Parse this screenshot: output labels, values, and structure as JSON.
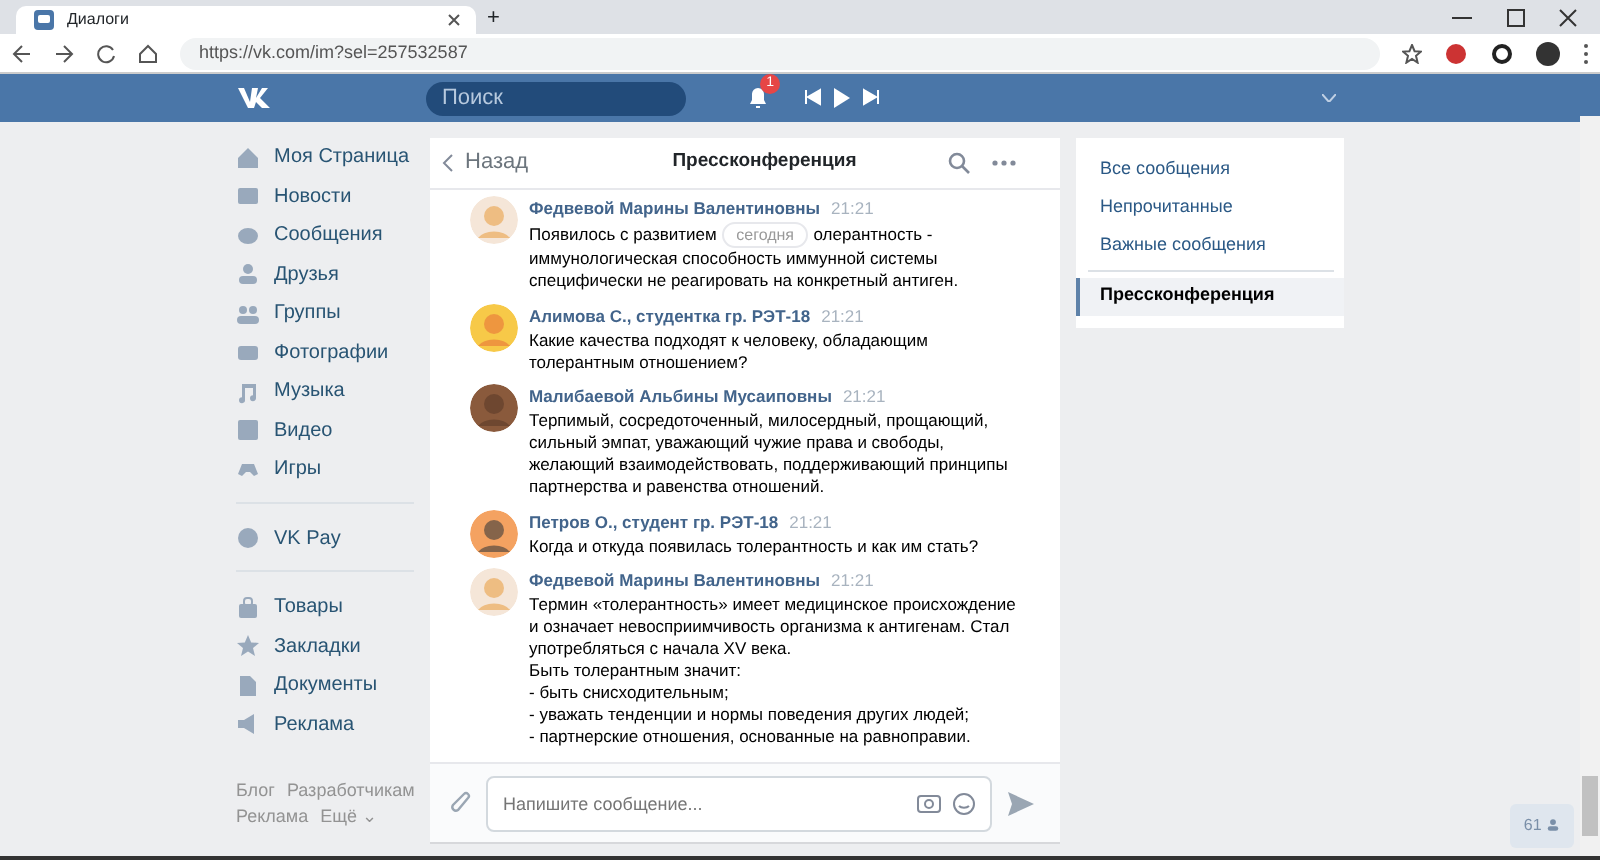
{
  "browser": {
    "tab_title": "Диалоги",
    "new_tab": "+",
    "url": "https://vk.com/im?sel=257532587"
  },
  "header": {
    "search_placeholder": "Поиск",
    "notification_count": "1"
  },
  "sidebar": {
    "groups": [
      [
        {
          "label": "Моя Страница"
        },
        {
          "label": "Новости"
        },
        {
          "label": "Сообщения"
        },
        {
          "label": "Друзья"
        },
        {
          "label": "Группы"
        },
        {
          "label": "Фотографии"
        },
        {
          "label": "Музыка"
        },
        {
          "label": "Видео"
        },
        {
          "label": "Игры"
        }
      ],
      [
        {
          "label": "VK Pay"
        }
      ],
      [
        {
          "label": "Товары"
        },
        {
          "label": "Закладки"
        },
        {
          "label": "Документы"
        },
        {
          "label": "Реклама"
        }
      ]
    ],
    "footer_links": [
      "Блог",
      "Разработчикам",
      "Реклама",
      "Ещё ⌄"
    ]
  },
  "chat": {
    "back": "Назад",
    "title": "Пресcконференция",
    "date_pill": "сегодня",
    "messages": [
      {
        "author": "Федвевой Марины Валентиновны",
        "time": "21:21",
        "text_parts": [
          "Появилось с развитием",
          "олерантность -",
          "иммунологическая способность иммунной системы\nспецифически не реагировать на конкретный антиген."
        ]
      },
      {
        "author": "Алимова С., студентка гр. РЭТ-18",
        "time": "21:21",
        "text_parts": [
          "Какие качества подходят к человеку, обладающим\nтолерантным отношением?"
        ]
      },
      {
        "author": "Малибаевой Альбины Мусаиповны",
        "time": "21:21",
        "text_parts": [
          "Терпимый, сосредоточенный, милосердный, прощающий,\nсильный эмпат, уважающий чужие права и свободы,\nжелающий взаимодействовать, поддерживающий принципы\nпартнерства и равенства отношений."
        ]
      },
      {
        "author": "Петров О., студент гр. РЭТ-18",
        "time": "21:21",
        "text_parts": [
          "Когда и откуда появилась толерантность и как им стать?"
        ]
      },
      {
        "author": "Федвевой Марины Валентиновны",
        "time": "21:21",
        "text_parts": [
          "Термин «толерантность» имеет медицинское происхождение\nи означает невосприимчивость организма к антигенам. Стал\nупотребляться с начала XV века.\nБыть толерантным значит:\n- быть снисходительным;\n- уважать тенденции и нормы поведения других людей;\n- партнерские отношения, основанные на равноправии."
        ]
      }
    ],
    "input_placeholder": "Напишите сообщение..."
  },
  "filters": [
    {
      "label": "Все сообщения",
      "selected": false
    },
    {
      "label": "Непрочитанные",
      "selected": false
    },
    {
      "label": "Важные сообщения",
      "selected": false
    },
    {
      "label": "Пресcконференция",
      "selected": true,
      "kind": "chat"
    }
  ],
  "online_count": "61"
}
